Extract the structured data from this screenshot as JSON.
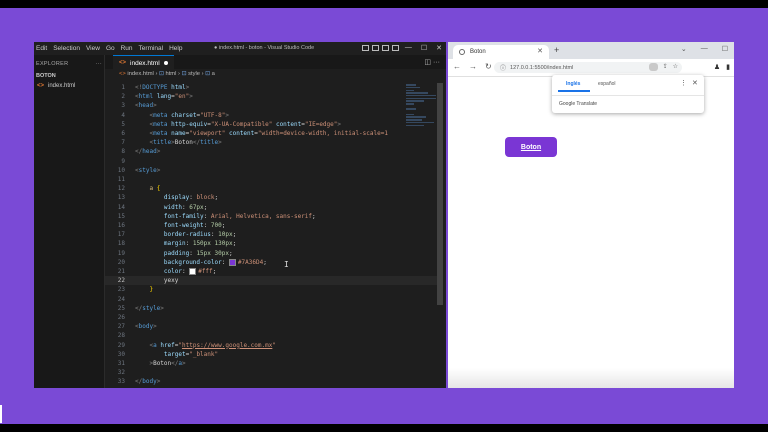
{
  "vscode": {
    "menu": [
      "Edit",
      "Selection",
      "View",
      "Go",
      "Run",
      "Terminal",
      "Help"
    ],
    "window_title": "● index.html - boton - Visual Studio Code",
    "sidebar": {
      "header": "EXPLORER",
      "header_more": "···",
      "folder": "BOTON",
      "file": "index.html"
    },
    "tab": {
      "label": "index.html"
    },
    "breadcrumb": [
      "index.html",
      "html",
      "style",
      "a"
    ],
    "code": [
      {
        "n": "1",
        "html": "<span class='t-pun'>&lt;!</span><span class='t-tag'>DOCTYPE</span> <span class='t-att'>html</span><span class='t-pun'>&gt;</span>"
      },
      {
        "n": "2",
        "html": "<span class='t-pun'>&lt;</span><span class='t-tag'>html</span> <span class='t-att'>lang</span><span class='t-txt'>=</span><span class='t-str'>\"en\"</span><span class='t-pun'>&gt;</span>"
      },
      {
        "n": "3",
        "html": "<span class='t-pun'>&lt;</span><span class='t-tag'>head</span><span class='t-pun'>&gt;</span>"
      },
      {
        "n": "4",
        "html": "    <span class='t-pun'>&lt;</span><span class='t-tag'>meta</span> <span class='t-att'>charset</span><span class='t-txt'>=</span><span class='t-str'>\"UTF-8\"</span><span class='t-pun'>&gt;</span>"
      },
      {
        "n": "5",
        "html": "    <span class='t-pun'>&lt;</span><span class='t-tag'>meta</span> <span class='t-att'>http-equiv</span><span class='t-txt'>=</span><span class='t-str'>\"X-UA-Compatible\"</span> <span class='t-att'>content</span><span class='t-txt'>=</span><span class='t-str'>\"IE=edge\"</span><span class='t-pun'>&gt;</span>"
      },
      {
        "n": "6",
        "html": "    <span class='t-pun'>&lt;</span><span class='t-tag'>meta</span> <span class='t-att'>name</span><span class='t-txt'>=</span><span class='t-str'>\"viewport\"</span> <span class='t-att'>content</span><span class='t-txt'>=</span><span class='t-str'>\"width=device-width, initial-scale=1</span>"
      },
      {
        "n": "7",
        "html": "    <span class='t-pun'>&lt;</span><span class='t-tag'>title</span><span class='t-pun'>&gt;</span><span class='t-txt'>Boton</span><span class='t-pun'>&lt;/</span><span class='t-tag'>title</span><span class='t-pun'>&gt;</span>"
      },
      {
        "n": "8",
        "html": "<span class='t-pun'>&lt;/</span><span class='t-tag'>head</span><span class='t-pun'>&gt;</span>"
      },
      {
        "n": "9",
        "html": ""
      },
      {
        "n": "10",
        "html": "<span class='t-pun'>&lt;</span><span class='t-tag'>style</span><span class='t-pun'>&gt;</span>"
      },
      {
        "n": "11",
        "html": ""
      },
      {
        "n": "12",
        "html": "    <span class='t-sel'>a</span> <span class='t-br'>{</span>"
      },
      {
        "n": "13",
        "html": "        <span class='t-prop'>display</span><span class='t-txt'>: </span><span class='t-val'>block</span><span class='t-txt'>;</span>"
      },
      {
        "n": "14",
        "html": "        <span class='t-prop'>width</span><span class='t-txt'>: </span><span class='t-num'>67px</span><span class='t-txt'>;</span>"
      },
      {
        "n": "15",
        "html": "        <span class='t-prop'>font-family</span><span class='t-txt'>: </span><span class='t-val'>Arial, Helvetica, sans-serif</span><span class='t-txt'>;</span>"
      },
      {
        "n": "16",
        "html": "        <span class='t-prop'>font-weight</span><span class='t-txt'>: </span><span class='t-num'>700</span><span class='t-txt'>;</span>"
      },
      {
        "n": "17",
        "html": "        <span class='t-prop'>border-radius</span><span class='t-txt'>: </span><span class='t-num'>10px</span><span class='t-txt'>;</span>"
      },
      {
        "n": "18",
        "html": "        <span class='t-prop'>margin</span><span class='t-txt'>: </span><span class='t-num'>150px 130px</span><span class='t-txt'>;</span>"
      },
      {
        "n": "19",
        "html": "        <span class='t-prop'>padding</span><span class='t-txt'>: </span><span class='t-num'>15px 30px</span><span class='t-txt'>;</span>"
      },
      {
        "n": "20",
        "html": "        <span class='t-prop'>background-color</span><span class='t-txt'>: </span><span class='sw' style='background:#7A36D4'></span><span class='t-val'>#7A36D4</span><span class='t-txt'>;</span>"
      },
      {
        "n": "21",
        "html": "        <span class='t-prop'>color</span><span class='t-txt'>: </span><span class='sw' style='background:#ffffff'></span><span class='t-val'>#fff</span><span class='t-txt'>;</span>"
      },
      {
        "n": "22",
        "html": "        <span class='t-txt'>yexy</span>",
        "current": true
      },
      {
        "n": "23",
        "html": "    <span class='t-br'>}</span>"
      },
      {
        "n": "24",
        "html": ""
      },
      {
        "n": "25",
        "html": "<span class='t-pun'>&lt;/</span><span class='t-tag'>style</span><span class='t-pun'>&gt;</span>"
      },
      {
        "n": "26",
        "html": ""
      },
      {
        "n": "27",
        "html": "<span class='t-pun'>&lt;</span><span class='t-tag'>body</span><span class='t-pun'>&gt;</span>"
      },
      {
        "n": "28",
        "html": ""
      },
      {
        "n": "29",
        "html": "    <span class='t-pun'>&lt;</span><span class='t-tag'>a</span> <span class='t-att'>href</span><span class='t-txt'>=</span><span class='t-str'>\"<u>https://www.google.com.mx</u>\"</span>"
      },
      {
        "n": "30",
        "html": "        <span class='t-att'>target</span><span class='t-txt'>=</span><span class='t-str'>\"_blank\"</span>"
      },
      {
        "n": "31",
        "html": "    <span class='t-pun'>&gt;</span><span class='t-txt'>Boton</span><span class='t-pun'>&lt;/</span><span class='t-tag'>a</span><span class='t-pun'>&gt;</span>"
      },
      {
        "n": "32",
        "html": ""
      },
      {
        "n": "33",
        "html": "<span class='t-pun'>&lt;/</span><span class='t-tag'>body</span><span class='t-pun'>&gt;</span>"
      }
    ]
  },
  "browser": {
    "tab_title": "Boton",
    "new_tab": "+",
    "url": "127.0.0.1:5500/index.html",
    "translate_popup": {
      "tab_active": "Inglés",
      "tab_other": "español",
      "brand": "Google Translate"
    },
    "page_link": "Boton"
  },
  "colors": {
    "background": "#7a4ad6",
    "button": "#7a36d4"
  }
}
